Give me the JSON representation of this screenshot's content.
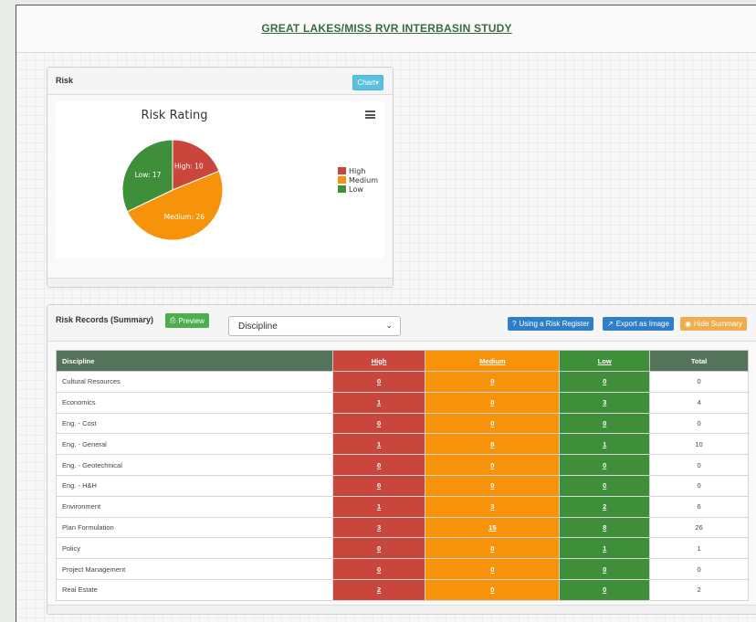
{
  "header": {
    "title": "GREAT LAKES/MISS RVR INTERBASIN STUDY"
  },
  "risk_panel": {
    "title": "Risk",
    "chart_button_label": "Chart▾"
  },
  "chart_data": {
    "type": "pie",
    "title": "Risk Rating",
    "categories": [
      "High",
      "Medium",
      "Low"
    ],
    "values": [
      10,
      26,
      17
    ],
    "slice_labels": [
      "High: 10",
      "Medium: 26",
      "Low: 17"
    ],
    "colors": [
      "#c9463d",
      "#f7930a",
      "#3f8e3a"
    ],
    "legend": [
      "High",
      "Medium",
      "Low"
    ],
    "legend_placement": "right"
  },
  "summary": {
    "title": "Risk Records (Summary)",
    "preview_label": "Preview",
    "select_value": "Discipline",
    "using_label": "Using a Risk Register",
    "export_label": "Export as Image",
    "hide_label": "Hide Summary",
    "columns": [
      "Discipline",
      "High",
      "Medium",
      "Low",
      "Total"
    ],
    "rows": [
      {
        "discipline": "Cultural Resources",
        "high": "0",
        "medium": "0",
        "low": "0",
        "total": "0"
      },
      {
        "discipline": "Economics",
        "high": "1",
        "medium": "0",
        "low": "3",
        "total": "4"
      },
      {
        "discipline": "Eng. - Cost",
        "high": "0",
        "medium": "0",
        "low": "0",
        "total": "0"
      },
      {
        "discipline": "Eng. - General",
        "high": "1",
        "medium": "8",
        "low": "1",
        "total": "10"
      },
      {
        "discipline": "Eng. - Geotechnical",
        "high": "0",
        "medium": "0",
        "low": "0",
        "total": "0"
      },
      {
        "discipline": "Eng. - H&H",
        "high": "0",
        "medium": "0",
        "low": "0",
        "total": "0"
      },
      {
        "discipline": "Environment",
        "high": "1",
        "medium": "3",
        "low": "2",
        "total": "6"
      },
      {
        "discipline": "Plan Formulation",
        "high": "3",
        "medium": "15",
        "low": "8",
        "total": "26"
      },
      {
        "discipline": "Policy",
        "high": "0",
        "medium": "0",
        "low": "1",
        "total": "1"
      },
      {
        "discipline": "Project Management",
        "high": "0",
        "medium": "0",
        "low": "0",
        "total": "0"
      },
      {
        "discipline": "Real Estate",
        "high": "2",
        "medium": "0",
        "low": "0",
        "total": "2"
      }
    ]
  }
}
